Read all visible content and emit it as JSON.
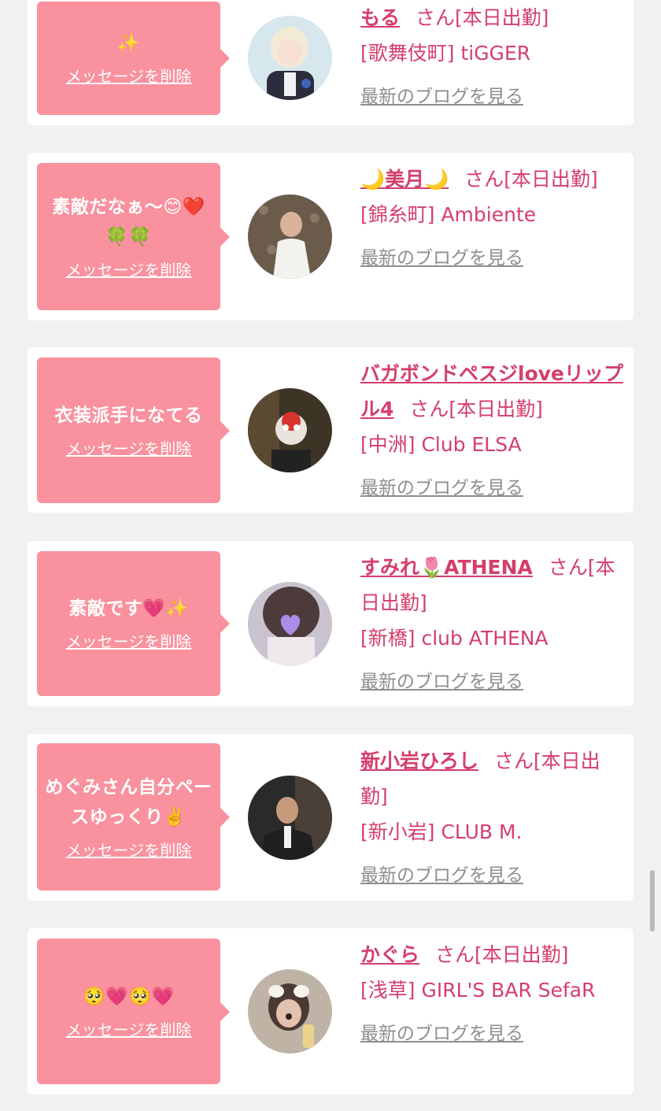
{
  "entries": [
    {
      "message": "✨",
      "delete_label": "メッセージを削除",
      "name": "もる",
      "san": "さん",
      "status": "[本日出勤]",
      "shop": "[歌舞伎町] tiGGER",
      "blog_label": "最新のブログを見る"
    },
    {
      "message": "素敵だなぁ〜😊❤️🍀🍀",
      "delete_label": "メッセージを削除",
      "name": "🌙美月🌙",
      "san": "さん",
      "status": "[本日出勤]",
      "shop": "[錦糸町] Ambiente",
      "blog_label": "最新のブログを見る"
    },
    {
      "message": "衣装派手になてる",
      "delete_label": "メッセージを削除",
      "name": "バガボンドペスジloveリップル4",
      "san": "さん",
      "status": "[本日出勤]",
      "shop": "[中洲] Club ELSA",
      "blog_label": "最新のブログを見る"
    },
    {
      "message": "素敵です💗✨",
      "delete_label": "メッセージを削除",
      "name": "すみれ🌷ATHENA",
      "san": "さん",
      "status": "[本日出勤]",
      "shop": "[新橋] club ATHENA",
      "blog_label": "最新のブログを見る"
    },
    {
      "message": "めぐみさん自分ペースゆっくり✌️",
      "delete_label": "メッセージを削除",
      "name": "新小岩ひろし",
      "san": "さん",
      "status": "[本日出勤]",
      "shop": "[新小岩] CLUB M.",
      "blog_label": "最新のブログを見る"
    },
    {
      "message": "🥺💗🥺💗",
      "delete_label": "メッセージを削除",
      "name": "かぐら",
      "san": "さん",
      "status": "[本日出勤]",
      "shop": "[浅草] GIRL'S BAR SefaR",
      "blog_label": "最新のブログを見る"
    }
  ],
  "colors": {
    "bubble": "#f9919e",
    "accent": "#d53e6b",
    "link_gray": "#8e8e8e",
    "page_bg": "#f1f1f1"
  }
}
